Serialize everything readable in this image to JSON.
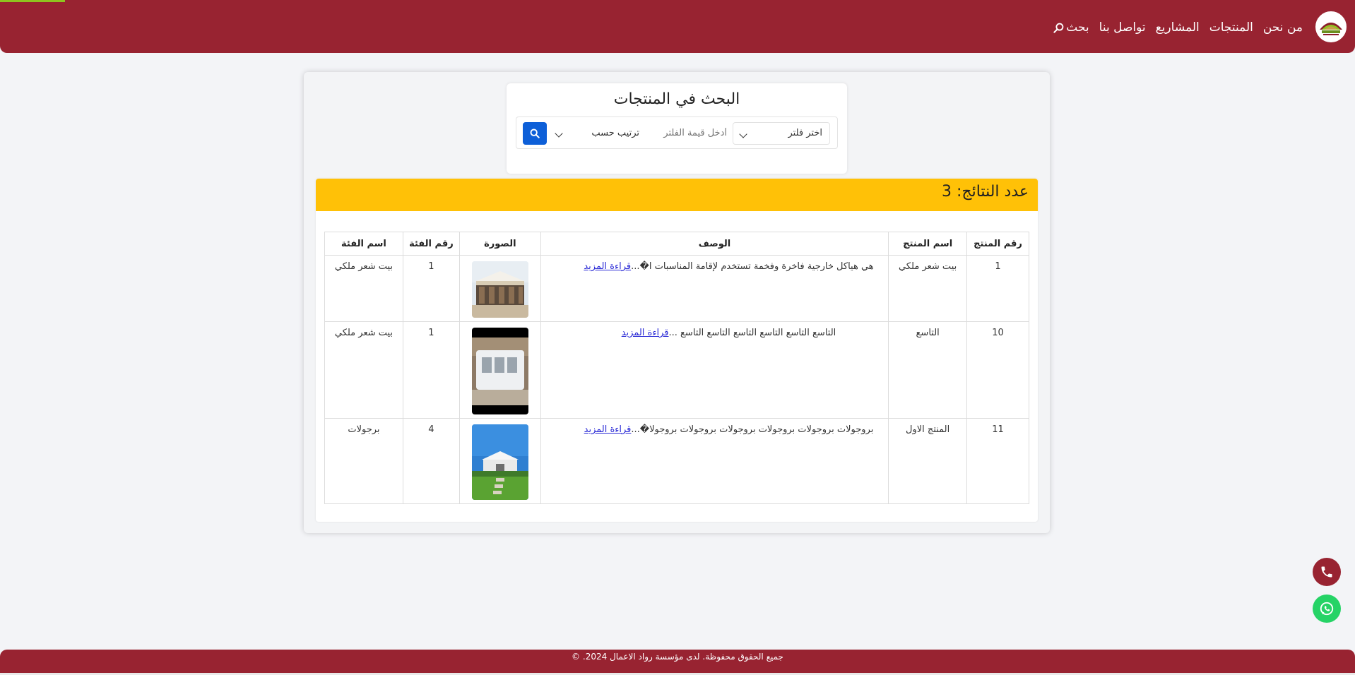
{
  "navbar": {
    "logo": "logo-icon",
    "links": [
      {
        "label": "من نحن"
      },
      {
        "label": "المنتجات"
      },
      {
        "label": "المشاريع"
      },
      {
        "label": "تواصل بنا"
      }
    ],
    "search_label": "بحث",
    "colors": {
      "brand": "#982331",
      "accent": "#8fc31f"
    }
  },
  "search": {
    "title": "البحث في المنتجات",
    "filter_select": "اختر فلتر",
    "filter_value_placeholder": "أدخل قيمة الفلتر",
    "sort_select": "ترتيب حسب",
    "button_icon": "search-icon"
  },
  "results": {
    "count_label": "عدد النتائج: 3",
    "header_color": "#ffc107",
    "columns": {
      "id": "رقم المنتج",
      "name": "اسم المنتج",
      "desc": "الوصف",
      "image": "الصورة",
      "cat_no": "رقم الفئة",
      "cat_name": "اسم الفئة"
    },
    "rows": [
      {
        "id": "1",
        "name": "بيت شعر ملكي",
        "desc": "هي هياكل خارجية فاخرة وفخمة تستخدم لإقامة المناسبات ا�...",
        "more": "قراءة المزيد",
        "cat_no": "1",
        "cat_name": "بيت شعر ملكي"
      },
      {
        "id": "10",
        "name": "التاسع",
        "desc": "التاسع التاسع التاسع التاسع التاسع التاسع ...",
        "more": "قراءة المزيد",
        "cat_no": "1",
        "cat_name": "بيت شعر ملكي"
      },
      {
        "id": "11",
        "name": "المنتج الاول",
        "desc": "بروجولات بروجولات بروجولات بروجولات بروجولات بروجولا�...",
        "more": "قراءة المزيد",
        "cat_no": "4",
        "cat_name": "برجولات"
      }
    ]
  },
  "floating": {
    "phone_icon": "phone-icon",
    "whatsapp_icon": "whatsapp-icon"
  },
  "footer": {
    "text": "جميع الحقوق محفوظة. لدى مؤسسة رواد الاعمال 2024. ©"
  }
}
